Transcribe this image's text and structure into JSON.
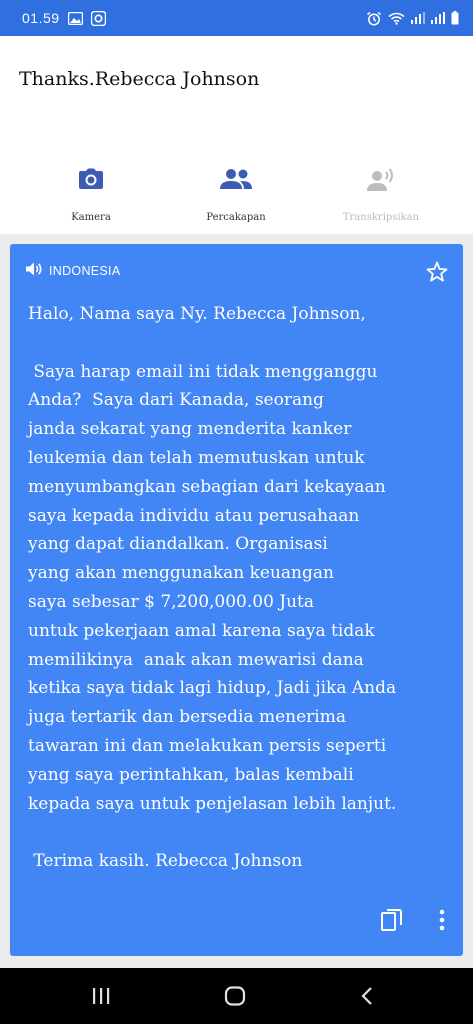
{
  "status_bar": {
    "time": "01.59",
    "left_icons": [
      "image-icon",
      "app-notification-icon"
    ],
    "right_icons": [
      "alarm-icon",
      "wifi-icon",
      "signal-icon",
      "signal-icon-2",
      "battery-icon"
    ]
  },
  "input": {
    "text": "Thanks.Rebecca Johnson"
  },
  "tabs": [
    {
      "label": "Kamera",
      "icon": "camera-icon",
      "enabled": true
    },
    {
      "label": "Percakapan",
      "icon": "people-icon",
      "enabled": true
    },
    {
      "label": "Transkripsikan",
      "icon": "transcribe-icon",
      "enabled": false
    }
  ],
  "card": {
    "language": "INDONESIA",
    "text": "Halo, Nama saya Ny. Rebecca Johnson,\n\n Saya harap email ini tidak mengganggu\nAnda?  Saya dari Kanada, seorang\njanda sekarat yang menderita kanker\nleukemia dan telah memutuskan untuk\nmenyumbangkan sebagian dari kekayaan\nsaya kepada individu atau perusahaan\nyang dapat diandalkan. Organisasi\nyang akan menggunakan keuangan\nsaya sebesar $ 7,200,000.00 Juta\nuntuk pekerjaan amal karena saya tidak\nmemilikinya  anak akan mewarisi dana\nketika saya tidak lagi hidup, Jadi jika Anda\njuga tertarik dan bersedia menerima\ntawaran ini dan melakukan persis seperti\nyang saya perintahkan, balas kembali\nkepada saya untuk penjelasan lebih lanjut.\n\n Terima kasih. Rebecca Johnson",
    "colors": {
      "background": "#4285f4",
      "text": "#ffffff"
    }
  },
  "colors": {
    "status_bar": "#2f6fe0",
    "tab_icon_active": "#3b5bb5",
    "tab_icon_disabled": "#bdbdbd"
  }
}
